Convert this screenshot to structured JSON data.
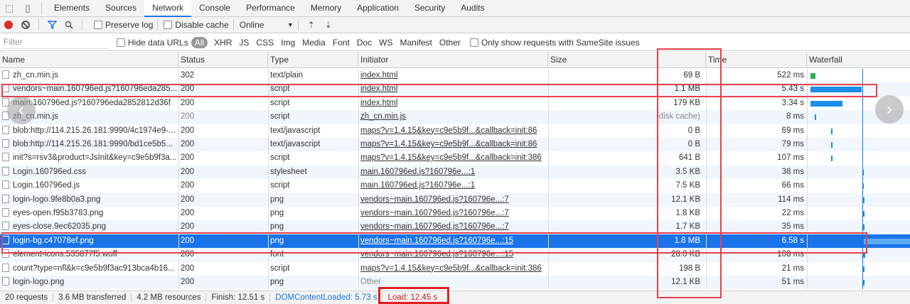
{
  "tabs": [
    "Elements",
    "Sources",
    "Network",
    "Console",
    "Performance",
    "Memory",
    "Application",
    "Security",
    "Audits"
  ],
  "active_tab": "Network",
  "toolbar": {
    "preserve_log": "Preserve log",
    "disable_cache": "Disable cache",
    "throttling": "Online"
  },
  "filterbar": {
    "placeholder": "Filter",
    "hide_data_urls": "Hide data URLs",
    "types": [
      "All",
      "XHR",
      "JS",
      "CSS",
      "Img",
      "Media",
      "Font",
      "Doc",
      "WS",
      "Manifest",
      "Other"
    ],
    "samesite": "Only show requests with SameSite issues"
  },
  "columns": [
    "Name",
    "Status",
    "Type",
    "Initiator",
    "Size",
    "Time",
    "Waterfall"
  ],
  "rows": [
    {
      "name": "zh_cn.min.js",
      "status": "302",
      "type": "text/plain",
      "initiator": "index.html",
      "size": "69 B",
      "time": "522 ms"
    },
    {
      "name": "vendors~main.160796ed.js?160796eda285...",
      "status": "200",
      "type": "script",
      "initiator": "index.html",
      "size": "1.1 MB",
      "time": "5.43 s"
    },
    {
      "name": "main.160796ed.js?160796eda2852812d36f",
      "status": "200",
      "type": "script",
      "initiator": "index.html",
      "size": "179 KB",
      "time": "3.34 s"
    },
    {
      "name": "zh_cn.min.js",
      "status": "200",
      "type": "script",
      "initiator": "zh_cn.min.js",
      "size": "(disk cache)",
      "time": "8 ms"
    },
    {
      "name": "blob:http://114.215.26.181:9990/4c1974e9-...",
      "status": "200",
      "type": "text/javascript",
      "initiator": "maps?v=1.4.15&key=c9e5b9f...&callback=init:86",
      "size": "0 B",
      "time": "69 ms"
    },
    {
      "name": "blob:http://114.215.26.181:9990/bd1ce5b5...",
      "status": "200",
      "type": "text/javascript",
      "initiator": "maps?v=1.4.15&key=c9e5b9f...&callback=init:86",
      "size": "0 B",
      "time": "79 ms"
    },
    {
      "name": "init?s=rsv3&product=JsInit&key=c9e5b9f3a...",
      "status": "200",
      "type": "script",
      "initiator": "maps?v=1.4.15&key=c9e5b9f...&callback=init:386",
      "size": "641 B",
      "time": "107 ms"
    },
    {
      "name": "Login.160796ed.css",
      "status": "200",
      "type": "stylesheet",
      "initiator": "main.160796ed.js?160796e...:1",
      "size": "3.5 KB",
      "time": "38 ms"
    },
    {
      "name": "Login.160796ed.js",
      "status": "200",
      "type": "script",
      "initiator": "main.160796ed.js?160796e...:1",
      "size": "7.5 KB",
      "time": "66 ms"
    },
    {
      "name": "login-logo.9fe8b0a3.png",
      "status": "200",
      "type": "png",
      "initiator": "vendors~main.160796ed.js?160796e...:7",
      "size": "12.1 KB",
      "time": "114 ms"
    },
    {
      "name": "eyes-open.f95b3783.png",
      "status": "200",
      "type": "png",
      "initiator": "vendors~main.160796ed.js?160796e...:7",
      "size": "1.8 KB",
      "time": "22 ms"
    },
    {
      "name": "eyes-close.9ec62035.png",
      "status": "200",
      "type": "png",
      "initiator": "vendors~main.160796ed.js?160796e...:7",
      "size": "1.7 KB",
      "time": "35 ms"
    },
    {
      "name": "login-bg.c47078ef.png",
      "status": "200",
      "type": "png",
      "initiator": "vendors~main.160796ed.js?160796e...:15",
      "size": "1.8 MB",
      "time": "6.58 s"
    },
    {
      "name": "element-icons.535877f5.woff",
      "status": "200",
      "type": "font",
      "initiator": "vendors~main.160796ed.js?160796e...:15",
      "size": "28.0 KB",
      "time": "108 ms"
    },
    {
      "name": "count?type=nfl&k=c9e5b9f3ac913bca4b16...",
      "status": "200",
      "type": "script",
      "initiator": "maps?v=1.4.15&key=c9e5b9f...&callback=init:386",
      "size": "198 B",
      "time": "21 ms"
    },
    {
      "name": "login-logo.png",
      "status": "200",
      "type": "png",
      "initiator": "Other",
      "size": "12.1 KB",
      "time": "51 ms"
    }
  ],
  "statusbar": {
    "requests": "20 requests",
    "transferred": "3.6 MB transferred",
    "resources": "4.2 MB resources",
    "finish": "Finish: 12.51 s",
    "dom_loaded": "DOMContentLoaded: 5.73 s",
    "load": "Load: 12.45 s"
  },
  "colors": {
    "selected_row": "#1a73e8",
    "annotation": "#e8404b",
    "waterfall_green": "#34a853",
    "waterfall_blue": "#1a8fe8"
  }
}
